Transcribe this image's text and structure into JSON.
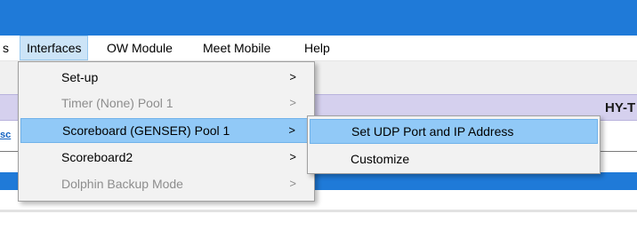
{
  "menubar": {
    "items": [
      {
        "label": "s"
      },
      {
        "label": "Interfaces"
      },
      {
        "label": "OW Module"
      },
      {
        "label": "Meet Mobile"
      },
      {
        "label": "Help"
      }
    ]
  },
  "background": {
    "header_label": "HY-T",
    "field_label": "sc"
  },
  "interfaces_menu": {
    "items": [
      {
        "label": "Set-up",
        "arrow": ">",
        "enabled": true
      },
      {
        "label": "Timer (None) Pool 1",
        "arrow": ">",
        "enabled": false
      },
      {
        "label": "Scoreboard (GENSER) Pool 1",
        "arrow": ">",
        "enabled": true,
        "highlighted": true
      },
      {
        "label": "Scoreboard2",
        "arrow": ">",
        "enabled": true
      },
      {
        "label": "Dolphin Backup Mode",
        "arrow": ">",
        "enabled": false
      }
    ]
  },
  "scoreboard_submenu": {
    "items": [
      {
        "label": "Set UDP Port and IP Address",
        "highlighted": true
      },
      {
        "label": "Customize"
      }
    ]
  },
  "colors": {
    "titlebar": "#1f7ad8",
    "menu_highlight": "#91c9f7",
    "menubar_active": "#cce4f7",
    "lavender_band": "#d5d0ee"
  }
}
